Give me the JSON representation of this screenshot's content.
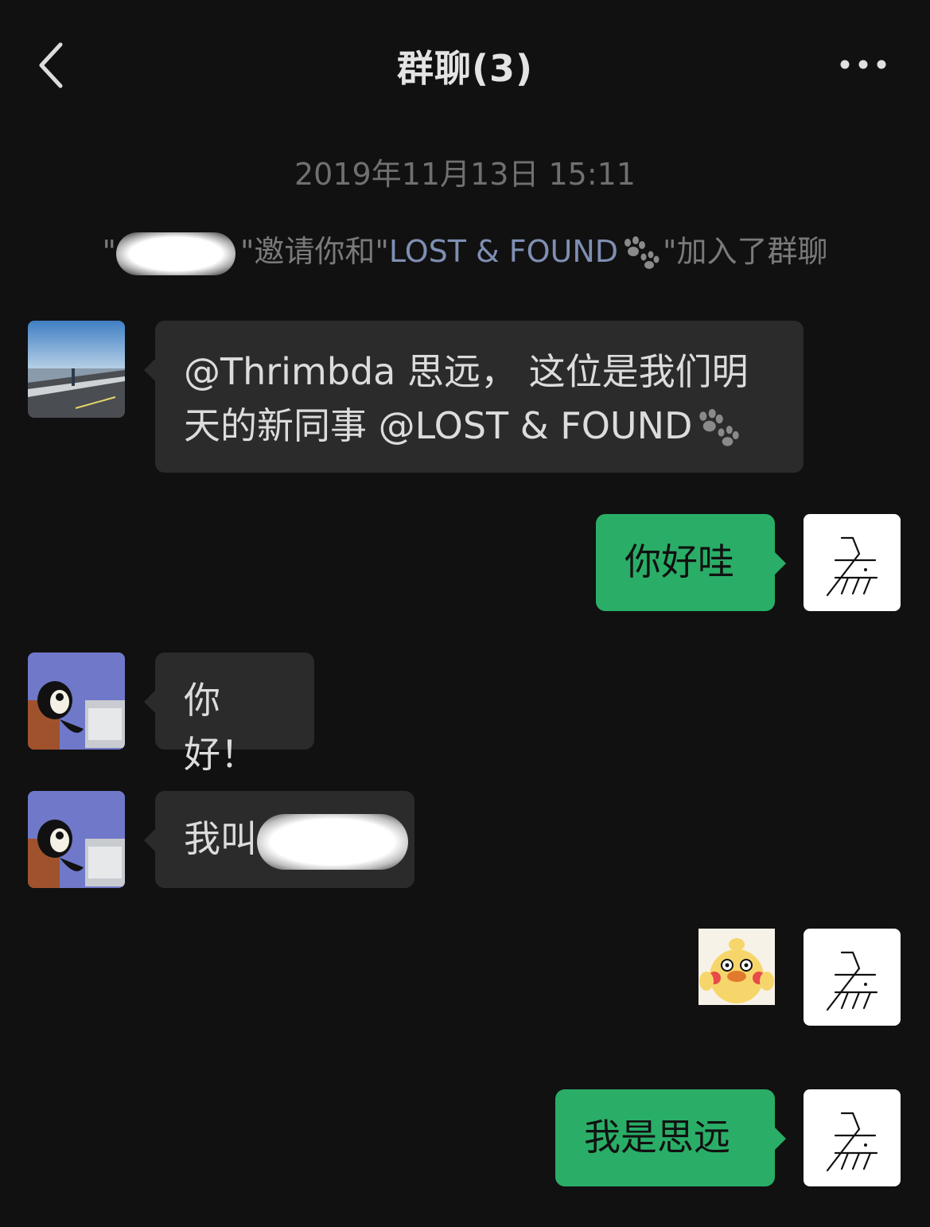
{
  "header": {
    "title": "群聊(3)"
  },
  "timestamp": "2019年11月13日 15:11",
  "system_message": {
    "prefix": "\"",
    "middle": "\"邀请你和\"",
    "invitee": "LOST & FOUND",
    "suffix": "\"加入了群聊"
  },
  "messages": [
    {
      "side": "left",
      "text": "@Thrimbda 思远， 这位是我们明天的新同事 @LOST & FOUND"
    },
    {
      "side": "right",
      "text": "你好哇"
    },
    {
      "side": "left",
      "text": "你好！"
    },
    {
      "side": "left",
      "text": "我叫"
    },
    {
      "side": "right",
      "type": "sticker"
    },
    {
      "side": "right",
      "text": "我是思远"
    }
  ],
  "colors": {
    "background": "#111111",
    "bubble_in": "#2b2b2b",
    "bubble_out": "#2aae67",
    "link": "#7f8fb3"
  },
  "icons": {
    "back": "chevron-left-icon",
    "more": "more-dots-icon",
    "paw": "paw-icon"
  }
}
